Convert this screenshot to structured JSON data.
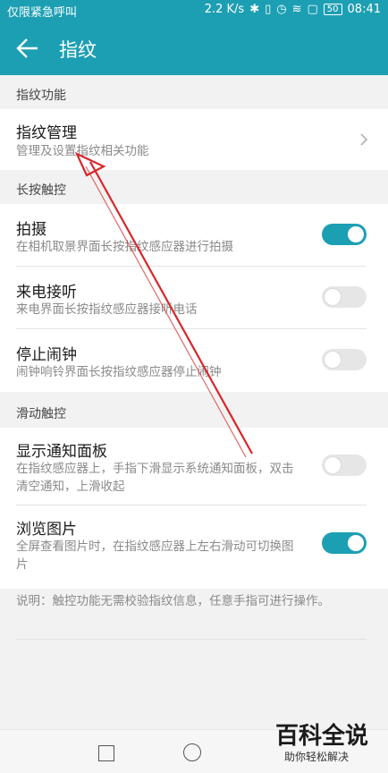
{
  "status_bar": {
    "left_text": "仅限紧急呼叫",
    "speed": "2.2 K/s",
    "battery": "50",
    "time": "08:41"
  },
  "app_bar": {
    "title": "指纹",
    "back_icon": "arrow-left-icon"
  },
  "sections": [
    {
      "header": "指纹功能",
      "items": [
        {
          "title": "指纹管理",
          "desc": "管理及设置指纹相关功能",
          "control": "chevron"
        }
      ]
    },
    {
      "header": "长按触控",
      "items": [
        {
          "title": "拍摄",
          "desc": "在相机取景界面长按指纹感应器进行拍摄",
          "toggle_on": true
        },
        {
          "title": "来电接听",
          "desc": "来电界面长按指纹感应器接听电话",
          "toggle_on": false
        },
        {
          "title": "停止闹钟",
          "desc": "闹钟响铃界面长按指纹感应器停止闹钟",
          "toggle_on": false
        }
      ]
    },
    {
      "header": "滑动触控",
      "items": [
        {
          "title": "显示通知面板",
          "desc": "在指纹感应器上，手指下滑显示系统通知面板，双击清空通知，上滑收起",
          "toggle_on": false
        },
        {
          "title": "浏览图片",
          "desc": "全屏查看图片时，在指纹感应器上左右滑动可切换图片",
          "toggle_on": true
        }
      ]
    }
  ],
  "note": "说明：触控功能无需校验指纹信息，任意手指可进行操作。",
  "watermark": {
    "title": "百科全说",
    "subtitle": "助你轻松解决"
  },
  "colors": {
    "accent": "#1d9fb3",
    "annotation_arrow": "#d8262b"
  }
}
